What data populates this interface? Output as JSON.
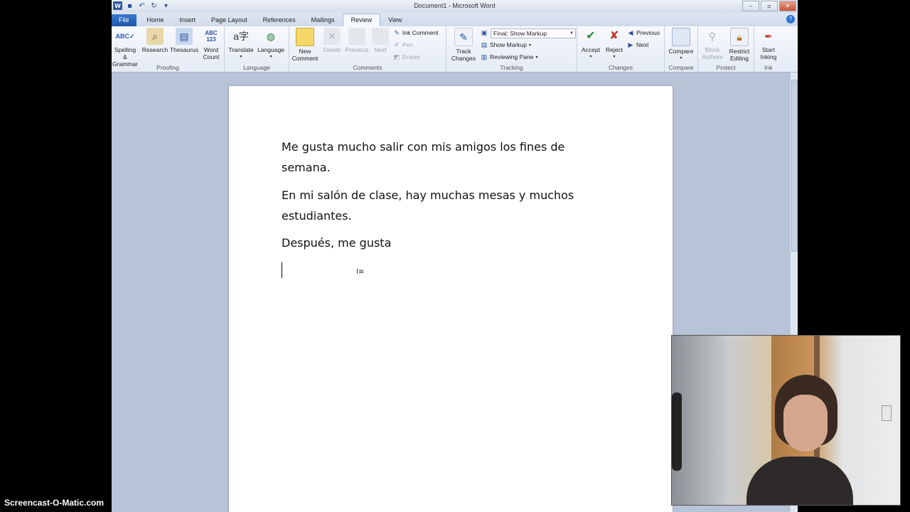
{
  "window": {
    "title": "Document1 - Microsoft Word",
    "buttons": [
      "–",
      "▫",
      "✕"
    ]
  },
  "tabs": [
    "File",
    "Home",
    "Insert",
    "Page Layout",
    "References",
    "Mailings",
    "Review",
    "View"
  ],
  "active_tab": "Review",
  "ribbon": {
    "proofing": {
      "label": "Proofing",
      "spelling": "Spelling &\nGrammar",
      "research": "Research",
      "thesaurus": "Thesaurus",
      "word_count": "Word\nCount"
    },
    "language": {
      "label": "Language",
      "translate": "Translate",
      "language_btn": "Language"
    },
    "comments": {
      "label": "Comments",
      "new_comment": "New\nComment",
      "delete": "Delete",
      "previous": "Previous",
      "next": "Next",
      "ink_comment": "Ink Comment",
      "pen": "Pen",
      "eraser": "Eraser"
    },
    "tracking": {
      "label": "Tracking",
      "track_changes": "Track\nChanges",
      "markup_select": "Final: Show Markup",
      "show_markup": "Show Markup",
      "reviewing_pane": "Reviewing Pane"
    },
    "changes": {
      "label": "Changes",
      "accept": "Accept",
      "reject": "Reject",
      "previous": "Previous",
      "next": "Next"
    },
    "compare": {
      "label": "Compare",
      "compare_btn": "Compare"
    },
    "protect": {
      "label": "Protect",
      "block_authors": "Block\nAuthors",
      "restrict_editing": "Restrict\nEditing"
    },
    "ink": {
      "label": "Ink",
      "start_inking": "Start\nInking"
    }
  },
  "document": {
    "paragraphs": [
      "Me gusta mucho salir con mis amigos los fines de semana.",
      "En mi salón de clase, hay muchas mesas y muchos estudiantes.",
      "Después, me gusta"
    ]
  },
  "watermark": "Screencast-O-Matic.com"
}
